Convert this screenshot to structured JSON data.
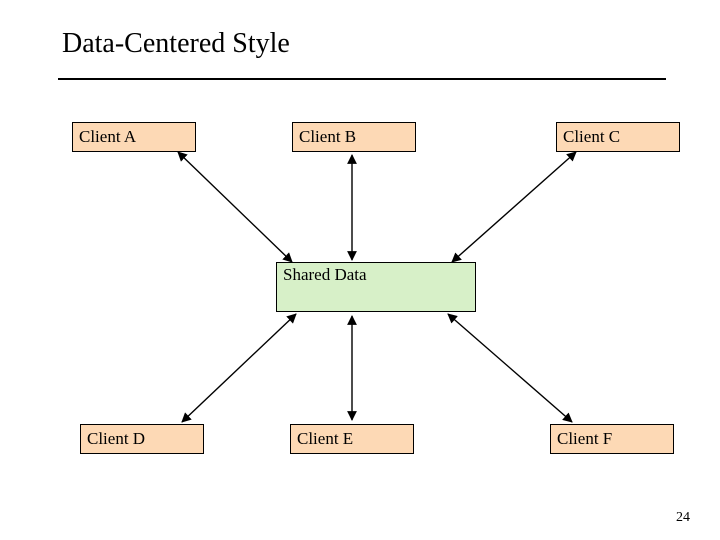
{
  "title": "Data-Centered Style",
  "clients": {
    "a": "Client A",
    "b": "Client B",
    "c": "Client C",
    "d": "Client D",
    "e": "Client E",
    "f": "Client F"
  },
  "shared": "Shared Data",
  "page_number": "24"
}
